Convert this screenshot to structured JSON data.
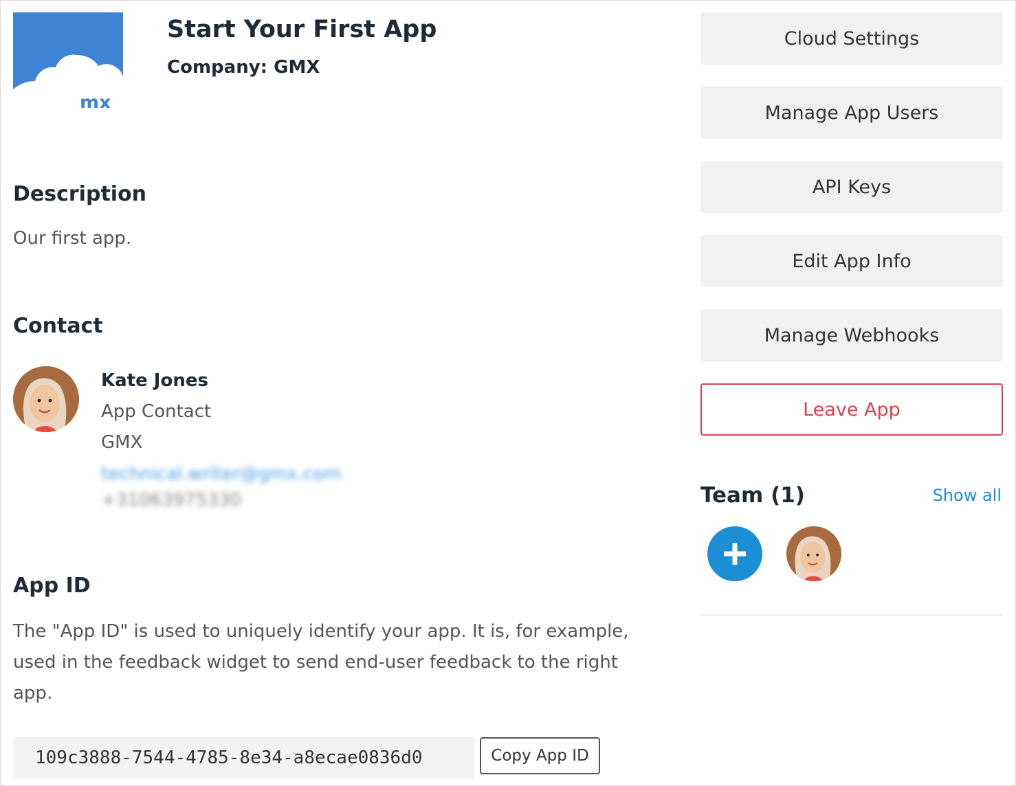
{
  "app": {
    "title": "Start Your First App",
    "company": "Company: GMX",
    "logo_text": "mx"
  },
  "description": {
    "heading": "Description",
    "text": "Our first app."
  },
  "contact": {
    "heading": "Contact",
    "name": "Kate Jones",
    "role": "App Contact",
    "company": "GMX",
    "email": "technical.writer@gmx.com",
    "phone": "+31063975330"
  },
  "app_id": {
    "heading": "App ID",
    "description": "The \"App ID\" is used to uniquely identify your app. It is, for example, used in the feedback widget to send end-user feedback to the right app.",
    "value": "109c3888-7544-4785-8e34-a8ecae0836d0",
    "copy_label": "Copy App ID"
  },
  "sidebar": {
    "buttons": [
      {
        "label": "Cloud Settings"
      },
      {
        "label": "Manage App Users"
      },
      {
        "label": "API Keys"
      },
      {
        "label": "Edit App Info"
      },
      {
        "label": "Manage Webhooks"
      },
      {
        "label": "Leave App"
      }
    ]
  },
  "team": {
    "heading": "Team (1)",
    "show_all": "Show all",
    "add_icon": "plus-icon"
  },
  "colors": {
    "primary": "#1b8ed6",
    "danger": "#d9434f",
    "logo_bg": "#3f83d5",
    "button_bg": "#f1f1f1",
    "heading": "#1e2a38"
  }
}
